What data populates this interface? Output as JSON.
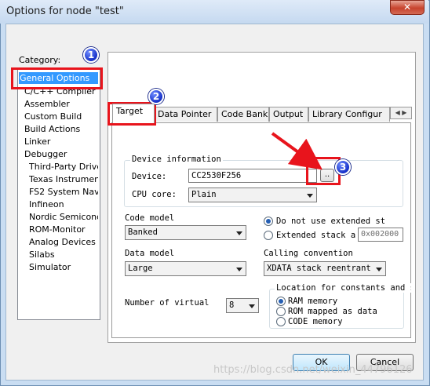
{
  "window": {
    "title": "Options for node \"test\"",
    "close_glyph": "✕"
  },
  "category": {
    "label": "Category:",
    "items": [
      "General Options",
      "C/C++ Compiler",
      "Assembler",
      "Custom Build",
      "Build Actions",
      "Linker",
      "Debugger"
    ],
    "debugger_items": [
      "Third-Party Driver",
      "Texas Instruments",
      "FS2 System Navig",
      "Infineon",
      "Nordic Semiconduc",
      "ROM-Monitor",
      "Analog Devices",
      "Silabs",
      "Simulator"
    ]
  },
  "tabs": [
    "Target",
    "Data Pointer",
    "Code Bank",
    "Output",
    "Library Configur"
  ],
  "tab_scroll": "◀ ▶",
  "target": {
    "device_info_title": "Device information",
    "device_label": "Device:",
    "device_value": "CC2530F256",
    "browse_label": "..",
    "cpu_core_label": "CPU core:",
    "cpu_core_value": "Plain",
    "code_model_label": "Code model",
    "code_model_value": "Banked",
    "not_use_extended_label": "Do not use extended st",
    "extended_stack_label": "Extended stack a",
    "extended_stack_value": "0x002000",
    "data_model_label": "Data model",
    "data_model_value": "Large",
    "calling_convention_label": "Calling convention",
    "calling_convention_value": "XDATA stack reentrant",
    "number_virtual_label": "Number of virtual",
    "number_virtual_value": "8",
    "location_title": "Location for constants and str",
    "loc_options": [
      "RAM memory",
      "ROM mapped as data",
      "CODE memory"
    ],
    "loc_selected": 0
  },
  "buttons": {
    "ok": "OK",
    "cancel": "Cancel"
  },
  "annotations": {
    "badge1": "1",
    "badge2": "2",
    "badge3": "3",
    "color": "#e8141c"
  },
  "watermark": "https://blog.csdn.net/weixin_44796126"
}
